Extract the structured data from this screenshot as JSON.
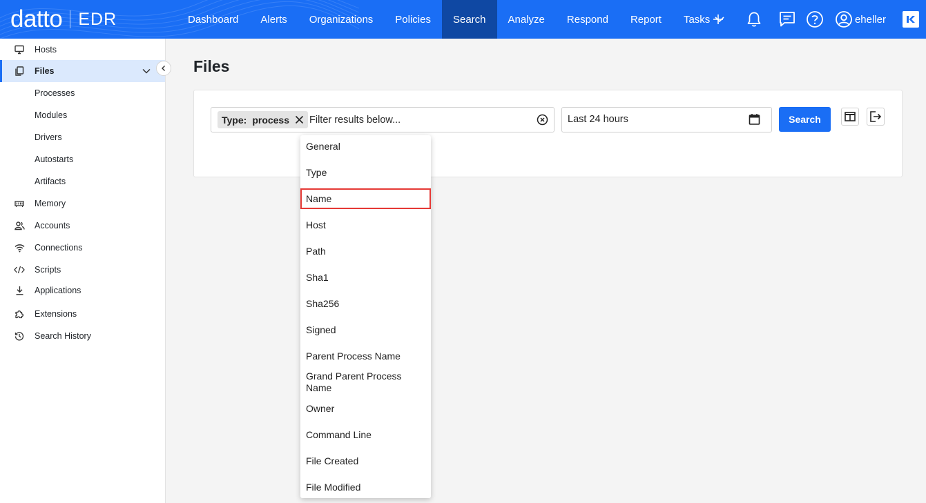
{
  "app": {
    "brand": "datto",
    "product": "EDR",
    "brand_color": "#1a6ef5",
    "active_nav_color": "#0f48a3"
  },
  "nav": {
    "items": [
      {
        "label": "Dashboard"
      },
      {
        "label": "Alerts"
      },
      {
        "label": "Organizations"
      },
      {
        "label": "Policies"
      },
      {
        "label": "Search",
        "active": true
      },
      {
        "label": "Analyze"
      },
      {
        "label": "Respond"
      },
      {
        "label": "Report"
      },
      {
        "label": "Tasks",
        "has_dropdown": true
      }
    ],
    "right_icons": [
      "plus-icon",
      "bell-icon",
      "chat-icon",
      "help-icon",
      "user-circle-icon",
      "kaseya-logo-icon"
    ],
    "username": "eheller"
  },
  "sidebar": {
    "items": [
      {
        "label": "Hosts",
        "icon": "monitor-icon"
      },
      {
        "label": "Files",
        "icon": "files-icon",
        "active": true,
        "expanded": true
      },
      {
        "label": "Processes"
      },
      {
        "label": "Modules"
      },
      {
        "label": "Drivers"
      },
      {
        "label": "Autostarts"
      },
      {
        "label": "Artifacts"
      },
      {
        "label": "Memory",
        "icon": "memory-icon"
      },
      {
        "label": "Accounts",
        "icon": "accounts-icon"
      },
      {
        "label": "Connections",
        "icon": "wifi-icon"
      },
      {
        "label": "Scripts",
        "icon": "code-icon"
      },
      {
        "label": "Applications",
        "icon": "download-icon"
      },
      {
        "label": "Extensions",
        "icon": "puzzle-icon"
      },
      {
        "label": "Search History",
        "icon": "history-icon"
      }
    ]
  },
  "main": {
    "title": "Files",
    "filter": {
      "chip_key": "Type:",
      "chip_value": "process",
      "placeholder": "Filter results below..."
    },
    "date_range": "Last 24 hours",
    "search_label": "Search"
  },
  "dropdown": {
    "items": [
      {
        "label": "General"
      },
      {
        "label": "Type"
      },
      {
        "label": "Name",
        "focused": true
      },
      {
        "label": "Host"
      },
      {
        "label": "Path"
      },
      {
        "label": "Sha1"
      },
      {
        "label": "Sha256"
      },
      {
        "label": "Signed"
      },
      {
        "label": "Parent Process Name"
      },
      {
        "label": "Grand Parent Process Name"
      },
      {
        "label": "Owner"
      },
      {
        "label": "Command Line"
      },
      {
        "label": "File Created"
      },
      {
        "label": "File Modified"
      }
    ]
  }
}
